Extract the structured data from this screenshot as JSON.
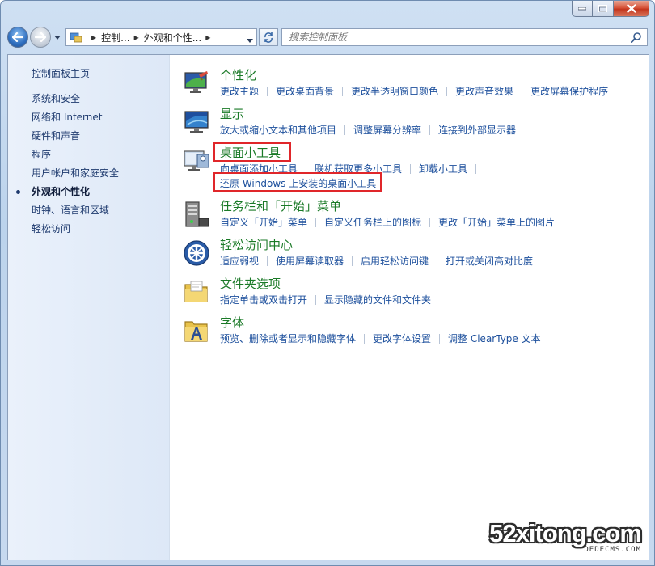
{
  "window": {
    "nav": {
      "breadcrumb": [
        "控制...",
        "外观和个性..."
      ],
      "search_placeholder": "搜索控制面板"
    }
  },
  "sidebar": {
    "home": "控制面板主页",
    "items": [
      {
        "label": "系统和安全"
      },
      {
        "label": "网络和 Internet"
      },
      {
        "label": "硬件和声音"
      },
      {
        "label": "程序"
      },
      {
        "label": "用户帐户和家庭安全"
      },
      {
        "label": "外观和个性化",
        "active": true
      },
      {
        "label": "时钟、语言和区域"
      },
      {
        "label": "轻松访问"
      }
    ]
  },
  "categories": [
    {
      "title": "个性化",
      "icon": "personalization-icon",
      "links": [
        "更改主题",
        "更改桌面背景",
        "更改半透明窗口颜色",
        "更改声音效果",
        "更改屏幕保护程序"
      ]
    },
    {
      "title": "显示",
      "icon": "display-icon",
      "links": [
        "放大或缩小文本和其他项目",
        "调整屏幕分辨率",
        "连接到外部显示器"
      ]
    },
    {
      "title": "桌面小工具",
      "icon": "gadgets-icon",
      "links": [
        "向桌面添加小工具",
        "联机获取更多小工具",
        "卸载小工具"
      ],
      "links2": [
        "还原 Windows 上安装的桌面小工具"
      ]
    },
    {
      "title": "任务栏和「开始」菜单",
      "icon": "taskbar-icon",
      "links": [
        "自定义「开始」菜单",
        "自定义任务栏上的图标",
        "更改「开始」菜单上的图片"
      ]
    },
    {
      "title": "轻松访问中心",
      "icon": "ease-of-access-icon",
      "links": [
        "适应弱视",
        "使用屏幕读取器",
        "启用轻松访问键",
        "打开或关闭高对比度"
      ]
    },
    {
      "title": "文件夹选项",
      "icon": "folder-options-icon",
      "links": [
        "指定单击或双击打开",
        "显示隐藏的文件和文件夹"
      ]
    },
    {
      "title": "字体",
      "icon": "fonts-icon",
      "links": [
        "预览、删除或者显示和隐藏字体",
        "更改字体设置",
        "调整 ClearType 文本"
      ]
    }
  ],
  "watermark": {
    "main": "52xitong.com",
    "sub": "DEDECMS.COM"
  },
  "colors": {
    "category_title": "#1a7a27",
    "link": "#1c4f9c",
    "highlight_box": "#e0262a"
  }
}
